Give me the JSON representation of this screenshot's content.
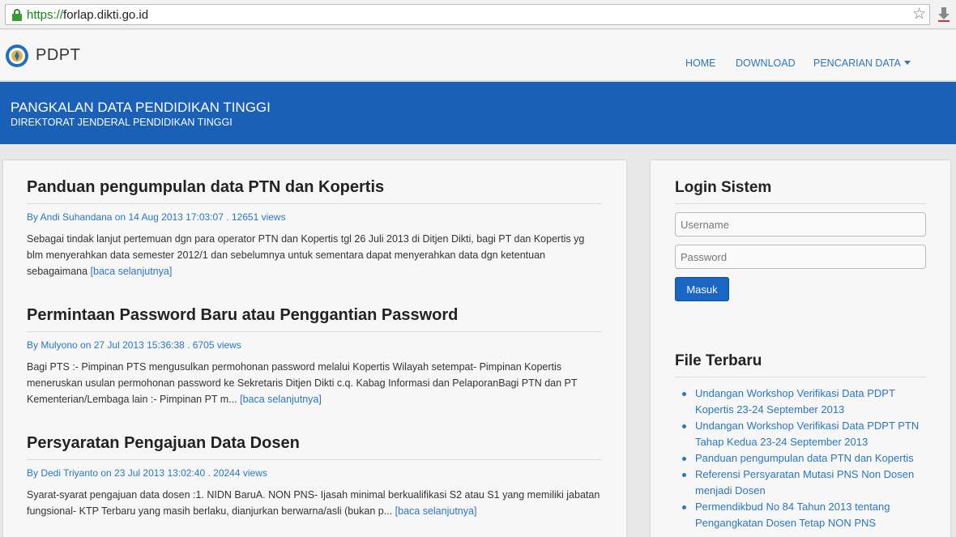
{
  "browser": {
    "url_scheme": "https://",
    "url_host": "forlap.dikti.go.id"
  },
  "nav": {
    "brand": "PDPT",
    "items": [
      {
        "label": "HOME"
      },
      {
        "label": "DOWNLOAD"
      },
      {
        "label": "PENCARIAN DATA"
      }
    ]
  },
  "banner": {
    "title": "PANGKALAN DATA PENDIDIKAN TINGGI",
    "subtitle": "DIREKTORAT JENDERAL PENDIDIKAN TINGGI"
  },
  "articles": [
    {
      "title": "Panduan pengumpulan data PTN dan Kopertis",
      "meta": "By Andi Suhandana on 14 Aug 2013 17:03:07 . 12651 views",
      "excerpt": "Sebagai tindak lanjut pertemuan dgn para operator PTN dan Kopertis tgl 26 Juli 2013 di Ditjen Dikti, bagi PT dan Kopertis yg blm menyerahkan data semester 2012/1 dan sebelumnya untuk sementara dapat menyerahkan data dgn ketentuan sebagaimana ",
      "read_more": "[baca selanjutnya]"
    },
    {
      "title": "Permintaan Password Baru atau Penggantian Password",
      "meta": "By Mulyono on 27 Jul 2013 15:36:38 . 6705 views",
      "excerpt": "Bagi PTS :- Pimpinan PTS mengusulkan permohonan password melalui Kopertis Wilayah setempat- Pimpinan Kopertis meneruskan usulan permohonan password ke Sekretaris Ditjen Dikti c.q. Kabag Informasi dan PelaporanBagi PTN dan PT Kementerian/Lembaga lain :- Pimpinan PT m... ",
      "read_more": "[baca selanjutnya]"
    },
    {
      "title": "Persyaratan Pengajuan Data Dosen",
      "meta": "By Dedi Triyanto on 23 Jul 2013 13:02:40 . 20244 views",
      "excerpt": "Syarat-syarat pengajuan data dosen :1.    NIDN BaruA. NON PNS-    Ijasah minimal berkualifikasi S2 atau S1 yang memiliki jabatan fungsional-    KTP Terbaru yang masih berlaku, dianjurkan berwarna/asli (bukan p... ",
      "read_more": "[baca selanjutnya]"
    }
  ],
  "login": {
    "heading": "Login Sistem",
    "username_placeholder": "Username",
    "password_placeholder": "Password",
    "submit_label": "Masuk"
  },
  "files": {
    "heading": "File Terbaru",
    "items": [
      {
        "label": "Undangan Workshop Verifikasi Data PDPT Kopertis 23-24 September 2013"
      },
      {
        "label": "Undangan Workshop Verifikasi Data PDPT PTN Tahap Kedua 23-24 September 2013"
      },
      {
        "label": "Panduan pengumpulan data PTN dan Kopertis"
      },
      {
        "label": "Referensi Persyaratan Mutasi PNS Non Dosen menjadi Dosen"
      },
      {
        "label": "Permendikbud No 84 Tahun 2013 tentang Pengangkatan Dosen Tetap NON PNS"
      }
    ]
  },
  "colors": {
    "banner": "#1a60b6",
    "link": "#2a77c0",
    "button": "#1a66c4"
  }
}
